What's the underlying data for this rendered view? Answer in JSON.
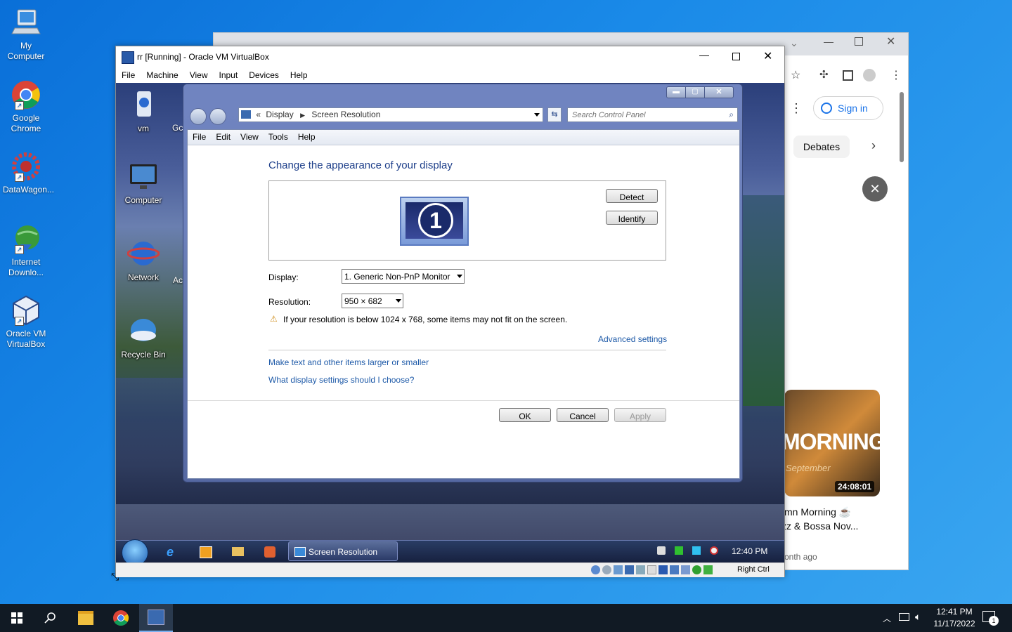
{
  "host_desktop": {
    "icons": [
      {
        "label": "My Computer"
      },
      {
        "label": "Google Chrome"
      },
      {
        "label": "DataWagon..."
      },
      {
        "label": "Internet Downlo..."
      },
      {
        "label": "Oracle VM VirtualBox"
      }
    ]
  },
  "chrome_window": {
    "sign_in": "Sign in",
    "chip": "Debates",
    "thumb_text": "MORNING",
    "thumb_sub": "September",
    "duration": "24:08:01",
    "video_title_1": "mn Morning ☕",
    "video_title_2": "zz & Bossa Nov...",
    "video_meta": "onth ago"
  },
  "vbox": {
    "title": "rr [Running] - Oracle VM VirtualBox",
    "menu": [
      "File",
      "Machine",
      "View",
      "Input",
      "Devices",
      "Help"
    ],
    "status_key": "Right Ctrl"
  },
  "guest_desktop": {
    "icons": [
      {
        "label": "vm"
      },
      {
        "label": "Computer"
      },
      {
        "label": "Network"
      },
      {
        "label": "Recycle Bin"
      }
    ],
    "partial_labels": [
      "Gc",
      "Ac"
    ]
  },
  "dialog": {
    "breadcrumb": {
      "sep": "«",
      "item1": "Display",
      "item2": "Screen Resolution"
    },
    "search_placeholder": "Search Control Panel",
    "menu": [
      "File",
      "Edit",
      "View",
      "Tools",
      "Help"
    ],
    "heading": "Change the appearance of your display",
    "monitor_number": "1",
    "detect": "Detect",
    "identify": "Identify",
    "display_label": "Display:",
    "display_value": "1. Generic Non-PnP Monitor",
    "resolution_label": "Resolution:",
    "resolution_value": "950 × 682",
    "warning": "If your resolution is below 1024 x 768, some items may not fit on the screen.",
    "advanced": "Advanced settings",
    "link1": "Make text and other items larger or smaller",
    "link2": "What display settings should I choose?",
    "ok": "OK",
    "cancel": "Cancel",
    "apply": "Apply"
  },
  "guest_taskbar": {
    "task": "Screen Resolution",
    "clock": "12:40 PM"
  },
  "host_taskbar": {
    "time": "12:41 PM",
    "date": "11/17/2022",
    "notification_count": "1"
  },
  "colors": {
    "host_taskbar": "#111a24",
    "link": "#1e5aa8",
    "heading": "#1e3f8a",
    "chrome_accent": "#1a73e8"
  }
}
